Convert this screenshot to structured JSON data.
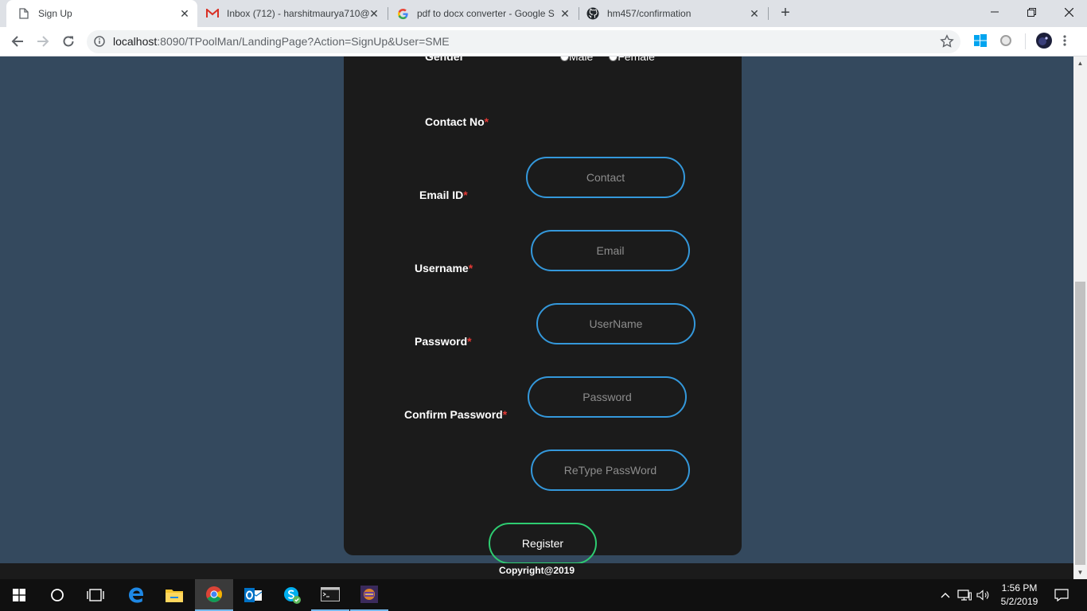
{
  "browser": {
    "tabs": [
      {
        "label": "Sign Up",
        "active": true,
        "icon": "page-icon"
      },
      {
        "label": "Inbox (712) - harshitmaurya710@",
        "active": false,
        "icon": "gmail-icon"
      },
      {
        "label": "pdf to docx converter - Google S",
        "active": false,
        "icon": "google-icon"
      },
      {
        "label": "hm457/confirmation",
        "active": false,
        "icon": "github-icon"
      }
    ],
    "url_host": "localhost",
    "url_rest": ":8090/TPoolMan/LandingPage?Action=SignUp&User=SME"
  },
  "form": {
    "gender_label": "Gender",
    "gender_options": [
      "Male",
      "Female"
    ],
    "required_mark": "*",
    "fields": [
      {
        "label": "Contact No",
        "placeholder": "Contact",
        "value": ""
      },
      {
        "label": "Email ID",
        "placeholder": "Email",
        "value": ""
      },
      {
        "label": "Username",
        "placeholder": "UserName",
        "value": ""
      },
      {
        "label": "Password",
        "placeholder": "Password",
        "value": ""
      },
      {
        "label": "Confirm Password",
        "placeholder": "ReType PassWord",
        "value": ""
      }
    ],
    "register_label": "Register"
  },
  "footer": {
    "text": "Copyright@2019"
  },
  "taskbar": {
    "time": "1:56 PM",
    "date": "5/2/2019"
  },
  "colors": {
    "page_bg": "#34495e",
    "card_bg": "#1b1b1b",
    "input_border": "#3498db",
    "button_border": "#2ecc71",
    "required": "#e53935"
  }
}
